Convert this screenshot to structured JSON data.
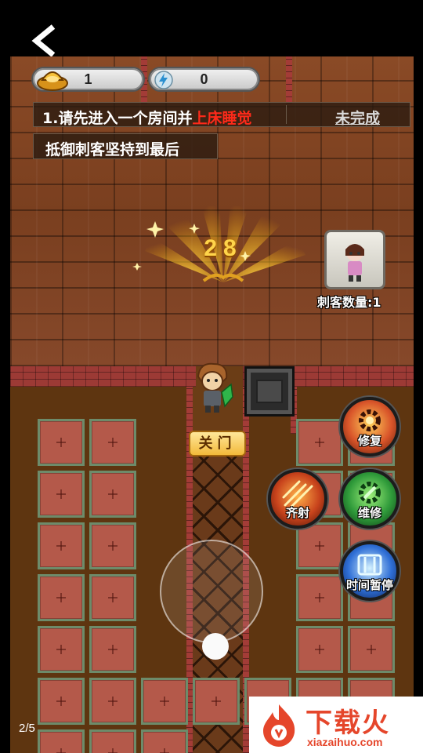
{
  "nav": {
    "back_icon": "chevron-left-icon"
  },
  "resources": {
    "gold": {
      "icon": "gold-ingot-icon",
      "value": "1"
    },
    "energy": {
      "icon": "lightning-icon",
      "value": "0"
    }
  },
  "tasks": {
    "task1": {
      "prefix": "1.请先进入一个房间并",
      "highlight": "上床睡觉",
      "status": "未完成"
    },
    "task2": {
      "text": "抵御刺客坚持到最后"
    }
  },
  "countdown": {
    "value": "28"
  },
  "assassin": {
    "portrait_icon": "assassin-portrait-icon",
    "count_label": "刺客数量:1"
  },
  "door_button": {
    "label": "关门"
  },
  "skills": [
    {
      "label": "修复",
      "icon": "repair-gear-icon",
      "color": "#d9552a"
    },
    {
      "label": "齐射",
      "icon": "volley-arrows-icon",
      "color": "#c8431c"
    },
    {
      "label": "维修",
      "icon": "wrench-gear-icon",
      "color": "#2f9a3a"
    },
    {
      "label": "时间暂停",
      "icon": "time-stop-icon",
      "color": "#2f6fd6"
    }
  ],
  "pager": {
    "text": "2/5"
  },
  "watermark": {
    "title": "下载火",
    "url": "xiazaihuo.com"
  },
  "colors": {
    "highlight_red": "#ff2a1a",
    "countdown_gold": "#ffd44a",
    "watermark_red": "#e5462b"
  }
}
